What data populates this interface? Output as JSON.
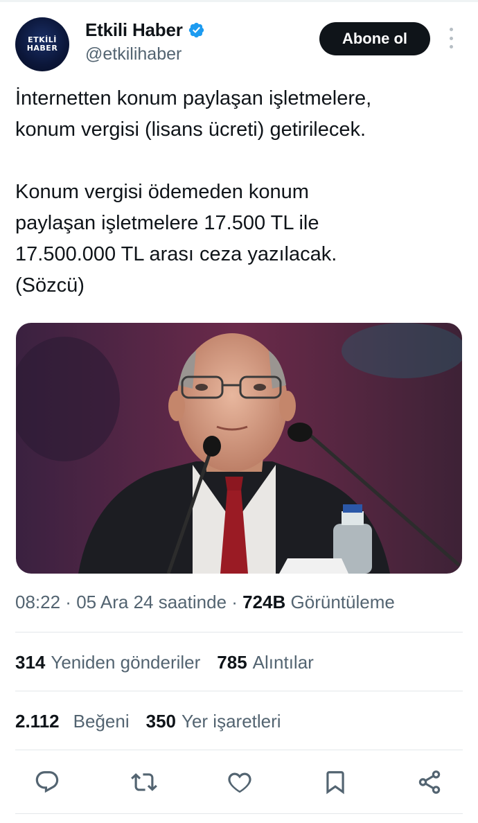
{
  "account": {
    "avatar_line1": "ETKİLİ",
    "avatar_line2": "HABER",
    "display_name": "Etkili Haber",
    "handle": "@etkilihaber",
    "verified": true,
    "follow_label": "Abone ol"
  },
  "tweet": {
    "paragraph1_line1": "İnternetten konum paylaşan işletmelere,",
    "paragraph1_line2": "konum vergisi (lisans ücreti) getirilecek.",
    "paragraph2_line1": "Konum vergisi ödemeden konum",
    "paragraph2_line2": "paylaşan işletmelere 17.500 TL ile",
    "paragraph2_line3": "17.500.000 TL arası ceza yazılacak.",
    "paragraph2_line4": "(Sözcü)"
  },
  "meta": {
    "time": "08:22",
    "separator": " · ",
    "date": "05 Ara 24 saatinde",
    "views_count": "724B",
    "views_label": "Görüntüleme"
  },
  "stats": {
    "reposts_count": "314",
    "reposts_label": "Yeniden gönderiler",
    "quotes_count": "785",
    "quotes_label": "Alıntılar",
    "likes_count": "2.112",
    "likes_label": "Beğeni",
    "bookmarks_count": "350",
    "bookmarks_label": "Yer işaretleri"
  },
  "actions": [
    "reply-icon",
    "repost-icon",
    "like-icon",
    "bookmark-icon",
    "share-icon"
  ],
  "colors": {
    "text_primary": "#0f1419",
    "text_secondary": "#536471",
    "verified_blue": "#1d9bf0",
    "divider": "#e3e7ea"
  }
}
